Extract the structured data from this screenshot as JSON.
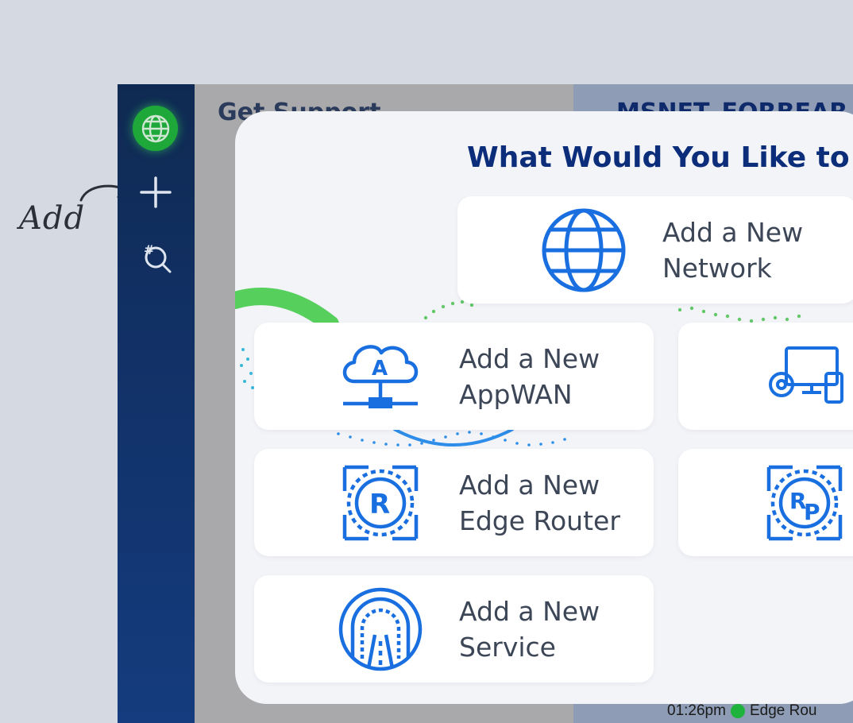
{
  "annotation": {
    "text": "Add"
  },
  "sidebar": {
    "logo_icon": "globe-icon",
    "items": [
      {
        "name": "add",
        "icon": "plus-icon"
      },
      {
        "name": "search",
        "icon": "hash-search-icon"
      }
    ]
  },
  "background": {
    "left_title": "Get Support",
    "right_title": "MSNET_FORBEAR",
    "status_time": "01:26pm",
    "status_text": "Edge Rou"
  },
  "modal": {
    "title": "What Would You Like to",
    "cards": [
      {
        "id": "network",
        "label": "Add a New\nNetwork",
        "icon": "globe-icon"
      },
      {
        "id": "appwan",
        "label": "Add a New\nAppWAN",
        "icon": "cloud-network-icon"
      },
      {
        "id": "endpoint",
        "label": "",
        "icon": "devices-gear-icon"
      },
      {
        "id": "edge-router",
        "label": "Add a New\nEdge Router",
        "icon": "router-r-icon"
      },
      {
        "id": "edge-router-policy",
        "label": "",
        "icon": "router-rp-icon"
      },
      {
        "id": "service",
        "label": "Add a New\nService",
        "icon": "tunnel-service-icon"
      }
    ]
  },
  "colors": {
    "accent": "#1a6fe0",
    "title": "#0c2e7a",
    "sidebar": "#12326a",
    "success": "#1fa83a"
  }
}
